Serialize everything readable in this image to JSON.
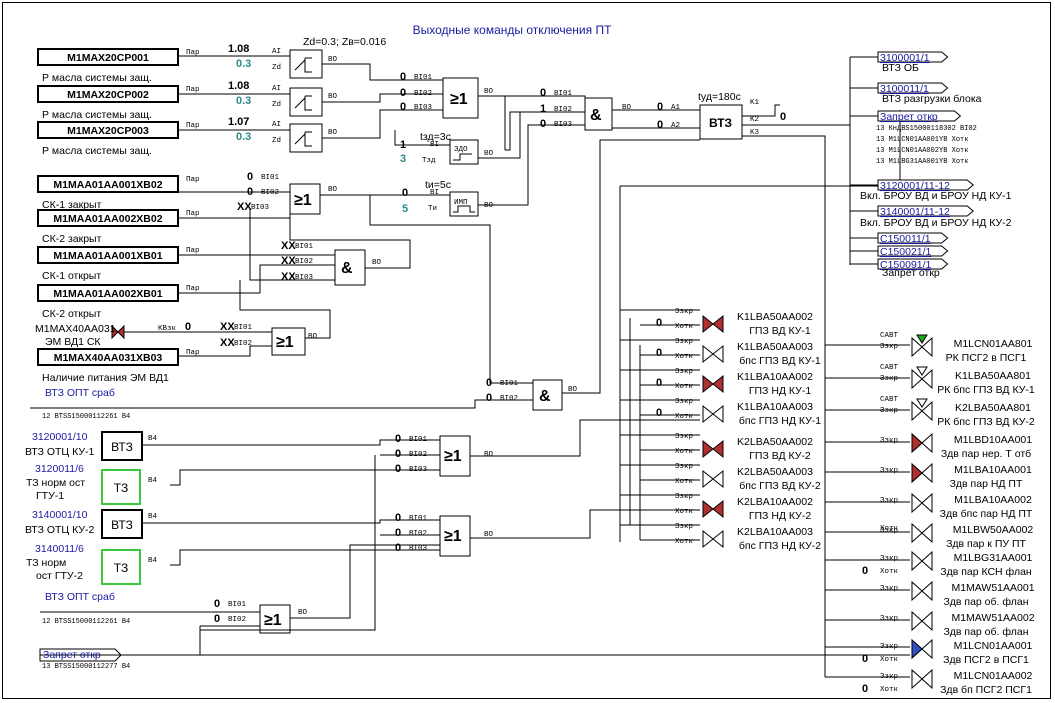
{
  "title": "Выходные команды отключения ПТ",
  "zd_setting": "Zd=0.3; Zв=0.016",
  "inputs": [
    {
      "tag": "M1MAX20CP001",
      "desc": "Р масла системы защ.",
      "val": "1.08",
      "setpoint": "0.3"
    },
    {
      "tag": "M1MAX20CP002",
      "desc": "Р масла системы защ.",
      "val": "1.08",
      "setpoint": "0.3"
    },
    {
      "tag": "M1MAX20CP003",
      "desc": "Р масла системы защ.",
      "val": "1.07",
      "setpoint": "0.3"
    },
    {
      "tag": "M1MAA01AA001XB02",
      "desc": "СК-1 закрыт"
    },
    {
      "tag": "M1MAA01AA002XB02",
      "desc": "СК-2 закрыт"
    },
    {
      "tag": "M1MAA01AA001XB01",
      "desc": "СК-1 открыт"
    },
    {
      "tag": "M1MAA01AA002XB01",
      "desc": "СК-2 открыт"
    },
    {
      "tag": "M1MAX40AA031XB03",
      "desc": "Наличие питания ЭМ ВД1"
    }
  ],
  "valve_in": {
    "tag": "M1MAX40AA031",
    "desc": "ЭМ ВД1 СК",
    "port": "KВзк"
  },
  "timers": {
    "tsd": "tзд=3с",
    "tsd_val": "3",
    "ti": "tи=5с",
    "ti_val": "5",
    "tyd": "tуд=180с"
  },
  "block_labels": {
    "zdo": "ЗДО",
    "imp": "ИМП",
    "vtz": "ВТЗ",
    "tz": "ТЗ"
  },
  "ports": {
    "ai": "AI",
    "zd": "Zd",
    "par": "Пар",
    "bo": "BO",
    "bi01": "BI01",
    "bi02": "BI02",
    "bi03": "BI03",
    "bi": "BI",
    "tzd": "Тзд",
    "ti": "Ти",
    "b4": "B4",
    "a1": "A1",
    "a2": "A2",
    "k1": "K1",
    "k2": "K2",
    "k3": "K3",
    "szkr": "Ззкр",
    "hotk": "Хотк",
    "savt": "САВТ",
    "szkr2": "Ззкр"
  },
  "signals": {
    "zero": "0",
    "one": "1",
    "xx": "XX"
  },
  "outputs": [
    {
      "ref": "3100001/1",
      "desc": "ВТЗ ОБ"
    },
    {
      "ref": "3100011/1",
      "desc": "ВТЗ разгрузки блока"
    },
    {
      "ref": "Запрет откр",
      "desc": ""
    },
    {
      "ref": "3120001/11-12",
      "desc": "Вкл. БРОУ ВД и БРОУ НД КУ-1"
    },
    {
      "ref": "3140001/11-12",
      "desc": "Вкл. БРОУ ВД и БРОУ НД КУ-2"
    },
    {
      "ref": "С150011/1",
      "desc": ""
    },
    {
      "ref": "С150021/1",
      "desc": ""
    },
    {
      "ref": "С150091/1",
      "desc": "Запрет откр"
    }
  ],
  "zapret_list": [
    "13 КнДВS15000118302 BI02",
    "13 M1LCN01AA001YB Хотк",
    "13 M1LCN01AA002YB Хотк",
    "13 M1LBG31AA001YB Хотк"
  ],
  "k1_value": "0",
  "vtz_opt": {
    "label": "ВТЗ ОПТ сраб",
    "ref": "12 BTSS15000112261 B4"
  },
  "zapret_otkr": {
    "label": "Запрет откр",
    "ref": "13 BTSS15000112277 B4"
  },
  "left_blocks": [
    {
      "ref": "3120001/10",
      "desc": "ВТЗ ОТЦ КУ-1",
      "type": "ВТЗ"
    },
    {
      "ref": "3120011/6",
      "desc1": "ТЗ норм ост",
      "desc2": "ГТУ-1",
      "type": "ТЗ"
    },
    {
      "ref": "3140001/10",
      "desc": "ВТЗ ОТЦ КУ-2",
      "type": "ВТЗ"
    },
    {
      "ref": "3140011/6",
      "desc1": "ТЗ норм",
      "desc2": "ост ГТУ-2",
      "type": "ТЗ"
    }
  ],
  "mid_valves": [
    {
      "tag": "K1LBA50AA002",
      "desc": "ГПЗ ВД КУ-1",
      "red": true
    },
    {
      "tag": "K1LBA50AA003",
      "desc": "бпс ГПЗ ВД КУ-1",
      "red": false
    },
    {
      "tag": "K1LBA10AA002",
      "desc": "ГПЗ НД КУ-1",
      "red": true
    },
    {
      "tag": "K1LBA10AA003",
      "desc": "бпс ГПЗ НД КУ-1",
      "red": false
    },
    {
      "tag": "K2LBA50AA002",
      "desc": "ГПЗ ВД КУ-2",
      "red": true
    },
    {
      "tag": "K2LBA50AA003",
      "desc": "бпс ГПЗ ВД КУ-2",
      "red": false
    },
    {
      "tag": "K2LBA10AA002",
      "desc": "ГПЗ НД КУ-2",
      "red": true
    },
    {
      "tag": "K2LBA10AA003",
      "desc": "бпс ГПЗ НД КУ-2",
      "red": false
    }
  ],
  "right_valves": [
    {
      "tag": "M1LCN01AA801",
      "desc": "РК ПСГ2 в ПСГ1",
      "kind": "green"
    },
    {
      "tag": "K1LBA50AA801",
      "desc": "РК бпс ГПЗ ВД КУ-1",
      "kind": "white"
    },
    {
      "tag": "K2LBA50AA801",
      "desc": "РК бпс ГПЗ ВД КУ-2",
      "kind": "white"
    },
    {
      "tag": "M1LBD10AA001",
      "desc": "Здв пар нер. Т отб",
      "kind": "red"
    },
    {
      "tag": "M1LBA10AA001",
      "desc": "Здв пар НД ПТ",
      "kind": "red"
    },
    {
      "tag": "M1LBA10AA002",
      "desc": "Здв бпс пар НД ПТ",
      "kind": "none"
    },
    {
      "tag": "M1LBW50AA002",
      "desc": "Здв пар к ПУ ПТ",
      "kind": "none"
    },
    {
      "tag": "M1LBG31AA001",
      "desc": "Здв пар КСН флан",
      "kind": "none"
    },
    {
      "tag": "M1MAW51AA001",
      "desc": "Здв пар об. флан",
      "kind": "none"
    },
    {
      "tag": "M1MAW51AA002",
      "desc": "Здв пар об. флан",
      "kind": "none"
    },
    {
      "tag": "M1LCN01AA001",
      "desc": "Здв ПСГ2 в ПСГ1",
      "kind": "blue"
    },
    {
      "tag": "M1LCN01AA002",
      "desc": "Здв бп ПСГ2 ПСГ1",
      "kind": "none"
    }
  ],
  "colors": {
    "wire": "#000000",
    "label_blue": "#1a1aa0",
    "setpoint": "#2a8a8a",
    "tz_border": "#3cc83c",
    "valve_red": "#b03030",
    "valve_green": "#1fa81f",
    "valve_blue": "#3050c0"
  }
}
